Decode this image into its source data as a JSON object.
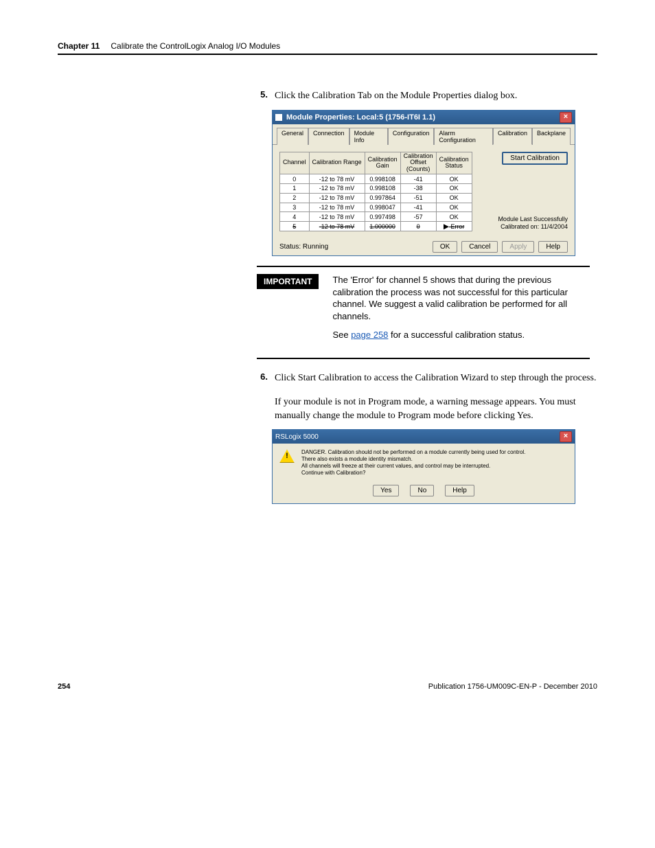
{
  "header": {
    "chapter": "Chapter 11",
    "title": "Calibrate the ControlLogix Analog I/O Modules"
  },
  "step5": {
    "number": "5.",
    "text": "Click the Calibration Tab on the Module Properties dialog box."
  },
  "dialog1": {
    "title": "Module Properties: Local:5 (1756-IT6I 1.1)",
    "tabs": [
      "General",
      "Connection",
      "Module Info",
      "Configuration",
      "Alarm Configuration",
      "Calibration",
      "Backplane"
    ],
    "activeTabIndex": 5,
    "tableHeaders": {
      "channel": "Channel",
      "range": "Calibration Range",
      "gain": "Calibration\nGain",
      "offset": "Calibration\nOffset\n(Counts)",
      "status": "Calibration\nStatus"
    },
    "rows": [
      {
        "channel": "0",
        "range": "-12 to 78 mV",
        "gain": "0.998108",
        "offset": "-41",
        "status": "OK",
        "strike": false
      },
      {
        "channel": "1",
        "range": "-12 to 78 mV",
        "gain": "0.998108",
        "offset": "-38",
        "status": "OK",
        "strike": false
      },
      {
        "channel": "2",
        "range": "-12 to 78 mV",
        "gain": "0.997864",
        "offset": "-51",
        "status": "OK",
        "strike": false
      },
      {
        "channel": "3",
        "range": "-12 to 78 mV",
        "gain": "0.998047",
        "offset": "-41",
        "status": "OK",
        "strike": false
      },
      {
        "channel": "4",
        "range": "-12 to 78 mV",
        "gain": "0.997498",
        "offset": "-57",
        "status": "OK",
        "strike": false
      },
      {
        "channel": "5",
        "range": "-12 to 78 mV",
        "gain": "1.000000",
        "offset": "0",
        "status": "Error",
        "strike": true
      }
    ],
    "startBtn": "Start Calibration",
    "lastCal": "Module Last Successfully\nCalibrated on: 11/4/2004",
    "status": "Status: Running",
    "buttons": {
      "ok": "OK",
      "cancel": "Cancel",
      "apply": "Apply",
      "help": "Help"
    }
  },
  "importantLabel": "IMPORTANT",
  "importantText1": "The 'Error' for channel 5 shows that during the previous calibration the process was not successful for this particular channel. We suggest a valid calibration be performed for all channels.",
  "importantText2a": "See ",
  "importantLink": "page 258",
  "importantText2b": " for a successful calibration status.",
  "step6": {
    "number": "6.",
    "text1": "Click Start Calibration to access the Calibration Wizard to step through the process.",
    "text2": "If your module is not in Program mode, a warning message appears. You must manually change the module to Program mode before clicking Yes."
  },
  "dialog2": {
    "title": "RSLogix 5000",
    "line1": "DANGER. Calibration should not be performed on a module currently being used for control.",
    "line2": "There also exists a module identity mismatch.",
    "line3": "All channels will freeze at their current values, and control may be interrupted.",
    "line4": "Continue with Calibration?",
    "buttons": {
      "yes": "Yes",
      "no": "No",
      "help": "Help"
    }
  },
  "footer": {
    "page": "254",
    "pub": "Publication 1756-UM009C-EN-P - December 2010"
  }
}
